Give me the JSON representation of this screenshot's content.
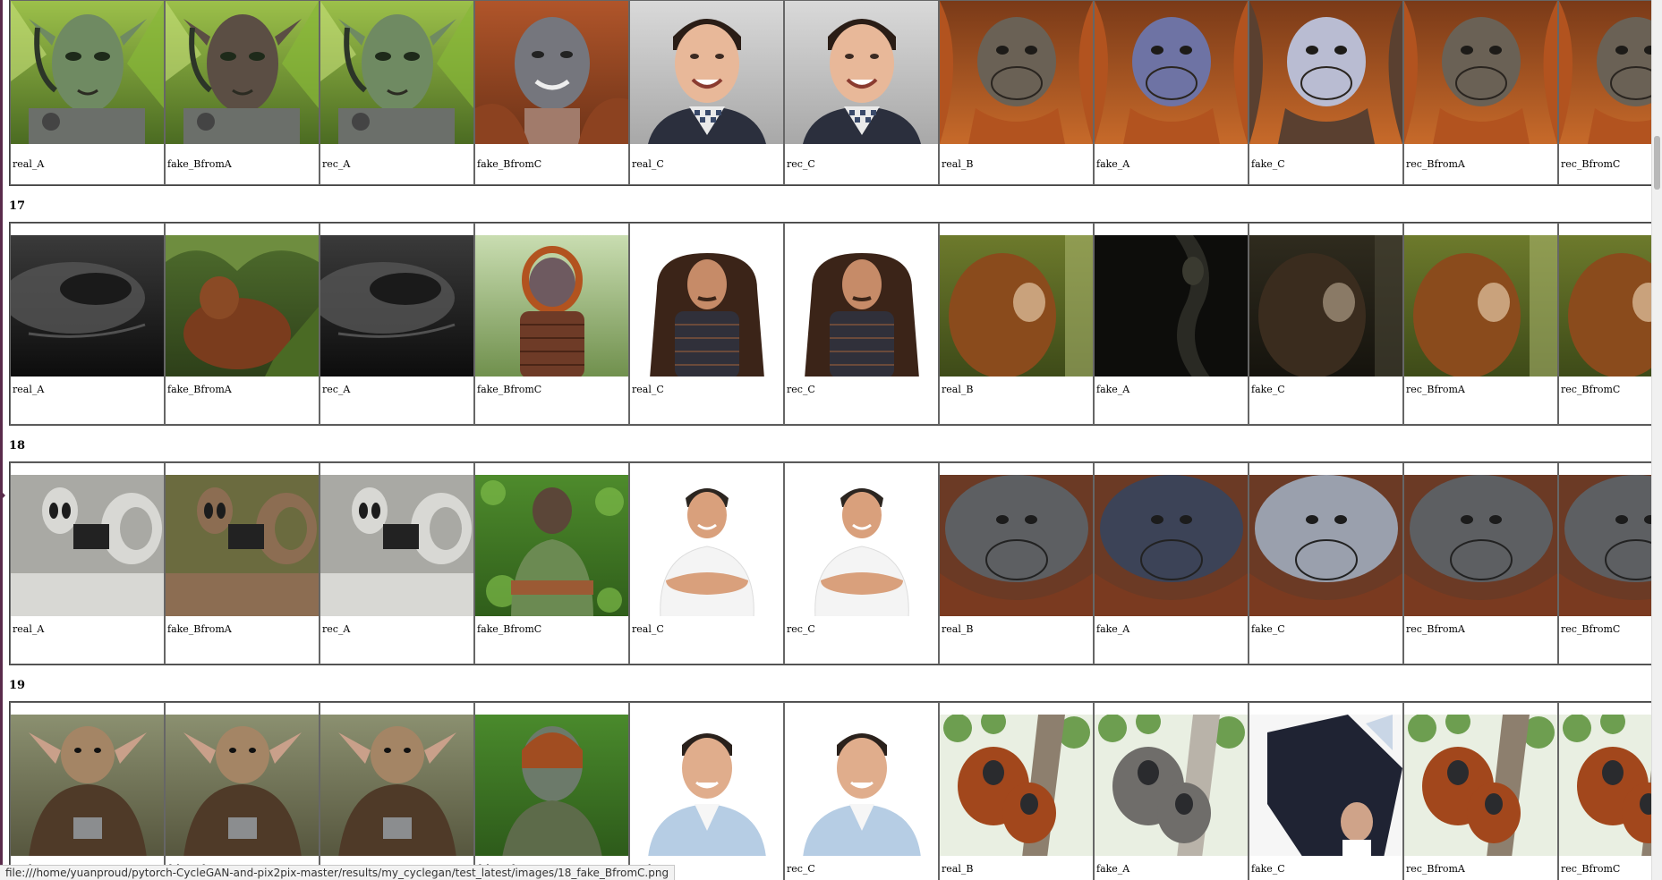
{
  "labels": [
    "real_A",
    "fake_BfromA",
    "rec_A",
    "fake_BfromC",
    "real_C",
    "rec_C",
    "real_B",
    "fake_A",
    "fake_C",
    "rec_BfromA",
    "rec_BfromC"
  ],
  "sections": [
    {
      "title": "",
      "images": [
        "alien-green",
        "alien-green-dark",
        "alien-green",
        "man-fur",
        "man-smiling",
        "man-smiling",
        "orangutan-face",
        "orangutan-blue",
        "orangutan-blue-light",
        "orangutan-face",
        "orangutan-face"
      ]
    },
    {
      "title": "17",
      "images": [
        "dark-alien",
        "orangutan-forest",
        "dark-alien",
        "orangutan-man",
        "man-chair",
        "man-chair",
        "orangutan-baby",
        "dark-shadow",
        "orangutan-baby-dark",
        "orangutan-baby",
        "orangutan-baby"
      ]
    },
    {
      "title": "18",
      "images": [
        "alien-grey",
        "alien-grey-brown",
        "alien-grey",
        "man-jungle",
        "man-arms",
        "man-arms",
        "orangutan-grey",
        "orangutan-grey-dark",
        "orangutan-grey-light",
        "orangutan-grey",
        "orangutan-grey"
      ]
    },
    {
      "title": "19",
      "images": [
        "creature-brown",
        "creature-brown",
        "creature-brown",
        "man-leaves",
        "man-blue-shirt",
        "man-blue-shirt",
        "orangutan-tree",
        "orangutan-tree-grey",
        "man-suit",
        "orangutan-tree",
        "orangutan-tree"
      ]
    }
  ],
  "status_url": "file:///home/yuanproud/pytorch-CycleGAN-and-pix2pix-master/results/my_cyclegan/test_latest/images/18_fake_BfromC.png",
  "colors": {
    "background": "#ffffff",
    "border": "#666666",
    "window_edge": "#5a2b4b"
  }
}
